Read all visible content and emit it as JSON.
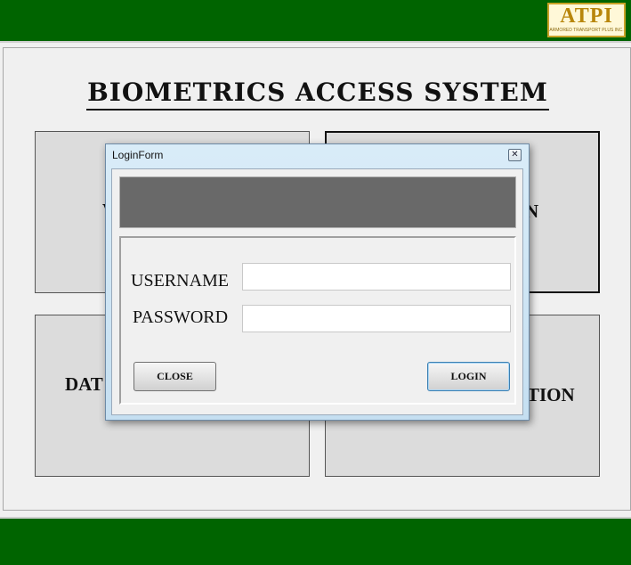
{
  "header": {
    "logo_text": "ATPI",
    "logo_subtext": "ARMORED TRANSPORT PLUS INC."
  },
  "app": {
    "title": "BIOMETRICS ACCESS SYSTEM"
  },
  "tiles": [
    {
      "label_visible": "V"
    },
    {
      "label_visible": "N"
    },
    {
      "label_visible": "DAT"
    },
    {
      "label_visible": "TION"
    }
  ],
  "dialog": {
    "title": "LoginForm",
    "close_glyph": "✕",
    "username_label": "USERNAME",
    "password_label": "PASSWORD",
    "username_value": "",
    "password_value": "",
    "close_label": "CLOSE",
    "login_label": "LOGIN"
  },
  "colors": {
    "header_green": "#006400",
    "banner_gray": "#696969",
    "tile_gray": "#dcdcdc"
  }
}
